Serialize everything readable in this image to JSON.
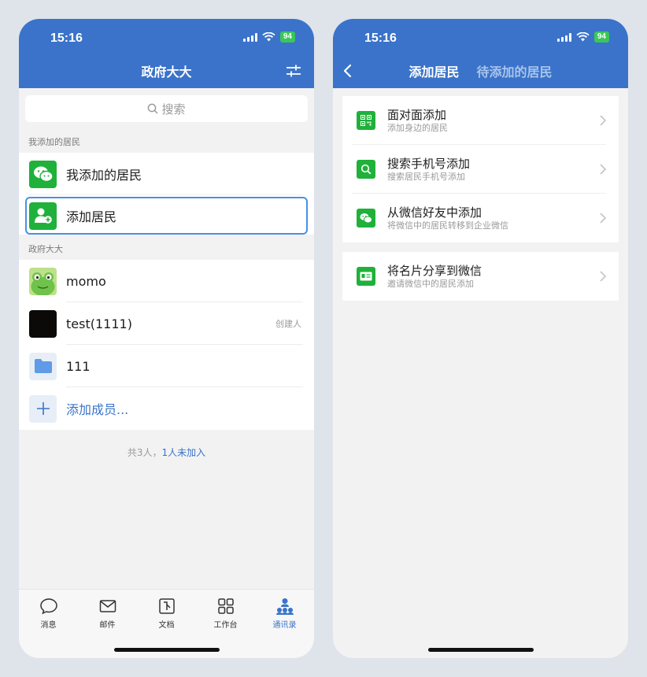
{
  "left": {
    "status": {
      "time": "15:16",
      "battery": "94"
    },
    "title": "政府大大",
    "search_placeholder": "搜索",
    "section_mine": "我添加的居民",
    "mine_items": [
      {
        "label": "我添加的居民",
        "icon": "wechat-icon"
      },
      {
        "label": "添加居民",
        "icon": "add-user-icon"
      }
    ],
    "section_org": "政府大大",
    "members": [
      {
        "name": "momo",
        "icon": "frog-avatar",
        "tag": ""
      },
      {
        "name": "test(1111)",
        "icon": "dark-avatar",
        "tag": "创建人"
      },
      {
        "name": "111",
        "icon": "folder-icon",
        "tag": ""
      }
    ],
    "add_member": "添加成员...",
    "count_prefix": "共3人，",
    "count_link": "1人未加入",
    "tabbar": [
      {
        "label": "消息",
        "icon": "chat-bubble-icon"
      },
      {
        "label": "邮件",
        "icon": "mail-icon"
      },
      {
        "label": "文档",
        "icon": "document-icon"
      },
      {
        "label": "工作台",
        "icon": "grid-icon"
      },
      {
        "label": "通讯录",
        "icon": "contacts-icon",
        "active": true
      }
    ]
  },
  "right": {
    "status": {
      "time": "15:16",
      "battery": "94"
    },
    "tabs": [
      "添加居民",
      "待添加的居民"
    ],
    "actions": [
      {
        "title": "面对面添加",
        "subtitle": "添加身边的居民",
        "icon": "qr-code-icon"
      },
      {
        "title": "搜索手机号添加",
        "subtitle": "搜索居民手机号添加",
        "icon": "search-icon"
      },
      {
        "title": "从微信好友中添加",
        "subtitle": "将微信中的居民转移到企业微信",
        "icon": "wechat-icon"
      }
    ],
    "share": {
      "title": "将名片分享到微信",
      "subtitle": "邀请微信中的居民添加",
      "icon": "business-card-icon"
    }
  },
  "colors": {
    "brand_blue": "#3a73c9",
    "green": "#1fb13a",
    "highlight": "#4a90e2"
  }
}
